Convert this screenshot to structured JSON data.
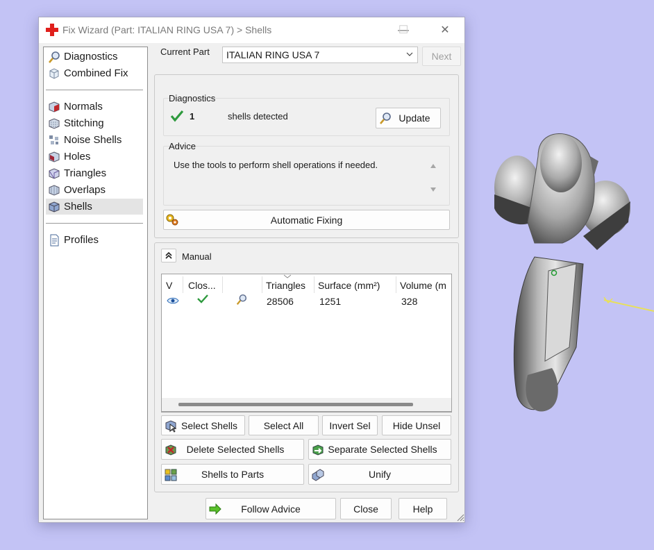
{
  "window": {
    "title": "Fix Wizard (Part: ITALIAN RING USA 7) > Shells",
    "minimize": "—",
    "maximize": "☐",
    "close": "✕"
  },
  "nav": {
    "top_items": [
      {
        "label": "Diagnostics",
        "icon": "magnifier-icon"
      },
      {
        "label": "Combined Fix",
        "icon": "cube-icon"
      }
    ],
    "fix_items": [
      {
        "label": "Normals",
        "icon": "normals-cube-icon"
      },
      {
        "label": "Stitching",
        "icon": "stitching-cube-icon"
      },
      {
        "label": "Noise Shells",
        "icon": "noise-shells-icon"
      },
      {
        "label": "Holes",
        "icon": "holes-cube-icon"
      },
      {
        "label": "Triangles",
        "icon": "triangles-cube-icon"
      },
      {
        "label": "Overlaps",
        "icon": "overlaps-cube-icon"
      },
      {
        "label": "Shells",
        "icon": "shells-cube-icon",
        "selected": true
      }
    ],
    "bottom_items": [
      {
        "label": "Profiles",
        "icon": "document-icon"
      }
    ]
  },
  "current_part": {
    "label": "Current Part",
    "value": "ITALIAN RING USA 7",
    "next": "Next"
  },
  "diagnostics": {
    "label": "Diagnostics",
    "count": "1",
    "message": "shells detected",
    "update": "Update"
  },
  "advice": {
    "label": "Advice",
    "text": "Use the tools to perform shell operations if needed."
  },
  "automatic_fixing": "Automatic Fixing",
  "manual": {
    "label": "Manual",
    "columns": [
      "V",
      "Clos...",
      "",
      "Triangles",
      "Surface (mm²)",
      "Volume (m"
    ],
    "rows": [
      {
        "triangles": "28506",
        "surface": "1251",
        "volume": "328"
      }
    ]
  },
  "buttons": {
    "select_shells": "Select Shells",
    "select_all": "Select All",
    "invert_sel": "Invert Sel",
    "hide_unsel": "Hide Unsel",
    "delete_selected": "Delete Selected Shells",
    "separate_selected": "Separate Selected Shells",
    "shells_to_parts": "Shells to Parts",
    "unify": "Unify",
    "follow_advice": "Follow Advice",
    "close": "Close",
    "help": "Help"
  },
  "colors": {
    "viewport_bg": "#c3c3f5",
    "check_green": "#2e9a3e",
    "app_red": "#e0201c"
  }
}
